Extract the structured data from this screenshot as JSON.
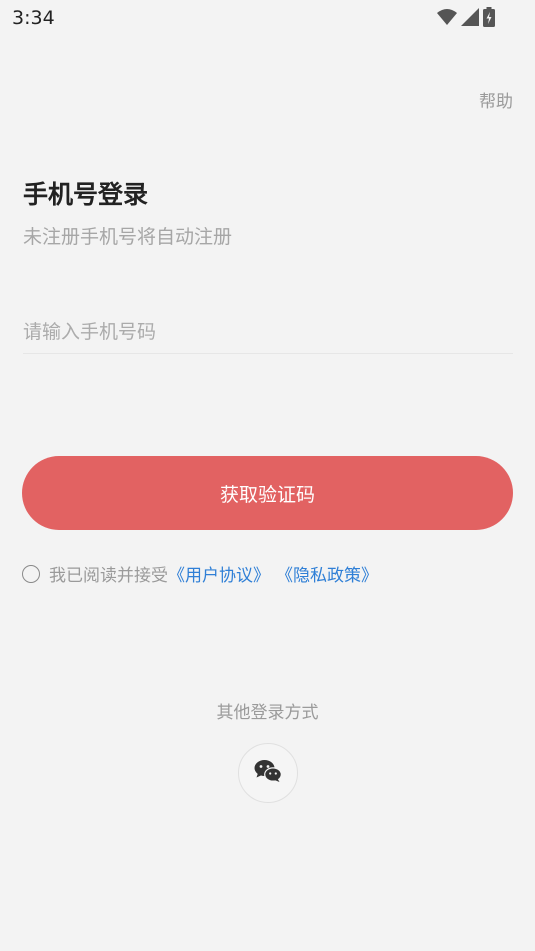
{
  "status_bar": {
    "time": "3:34",
    "icons": [
      "wifi-icon",
      "signal-icon",
      "battery-charging-icon"
    ]
  },
  "header": {
    "help_label": "帮助"
  },
  "login": {
    "title": "手机号登录",
    "subtitle": "未注册手机号将自动注册",
    "phone_placeholder": "请输入手机号码",
    "phone_value": "",
    "code_button_label": "获取验证码"
  },
  "agreement": {
    "prefix": "我已阅读并接受",
    "user_agreement": "《用户协议》",
    "privacy_policy": "《隐私政策》",
    "checked": false
  },
  "other_login": {
    "label": "其他登录方式",
    "methods": [
      "wechat-icon"
    ]
  },
  "colors": {
    "background": "#f3f3f3",
    "primary_button": "#e26262",
    "link": "#2f7fd6",
    "muted_text": "#a6a6a6"
  }
}
